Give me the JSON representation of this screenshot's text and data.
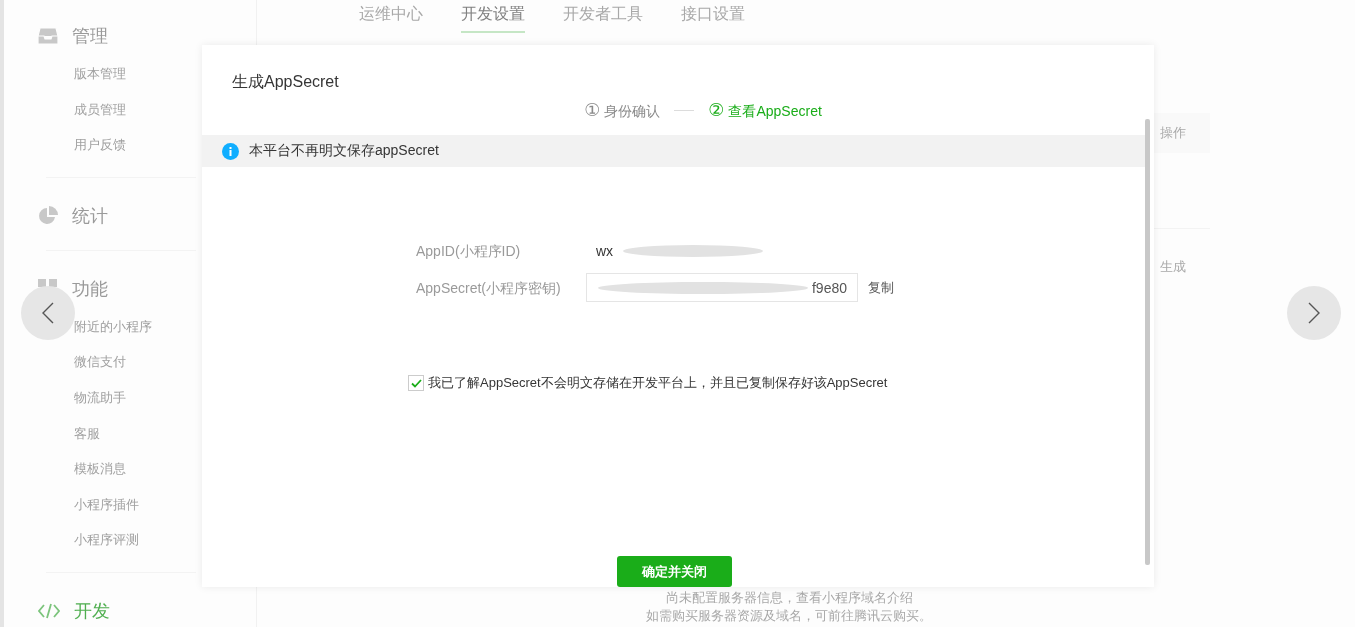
{
  "sidebar": {
    "groups": [
      {
        "title": "管理",
        "selected": false,
        "items": [
          "版本管理",
          "成员管理",
          "用户反馈"
        ]
      },
      {
        "title": "统计",
        "selected": false
      },
      {
        "title": "功能",
        "selected": false,
        "items": [
          "附近的小程序",
          "微信支付",
          "物流助手",
          "客服",
          "模板消息",
          "小程序插件",
          "小程序评测"
        ]
      },
      {
        "title": "开发",
        "selected": true
      }
    ]
  },
  "tabs": [
    {
      "label": "运维中心",
      "selected": false
    },
    {
      "label": "开发设置",
      "selected": true
    },
    {
      "label": "开发者工具",
      "selected": false
    },
    {
      "label": "接口设置",
      "selected": false
    }
  ],
  "background_table": {
    "header": "操作",
    "cell": "生成"
  },
  "background_notes": [
    "尚未配置服务器信息，查看小程序域名介绍",
    "如需购买服务器资源及域名，可前往腾讯云购买。"
  ],
  "dialog": {
    "title": "生成AppSecret",
    "steps": [
      {
        "number": "①",
        "label": "身份确认",
        "selected": false
      },
      {
        "number": "②",
        "label": "查看AppSecret",
        "selected": true
      }
    ],
    "notice": "本平台不再明文保存appSecret",
    "fields": [
      {
        "kind": "text",
        "label": "AppID(小程序ID)",
        "value": "wx"
      },
      {
        "kind": "input",
        "label": "AppSecret(小程序密钥)",
        "value": "f9e80",
        "action": "复制"
      }
    ],
    "agreement": {
      "label": "我已了解AppSecret不会明文存储在开发平台上，并且已复制保存好该AppSecret",
      "checked": true
    },
    "button": "确定并关闭"
  }
}
